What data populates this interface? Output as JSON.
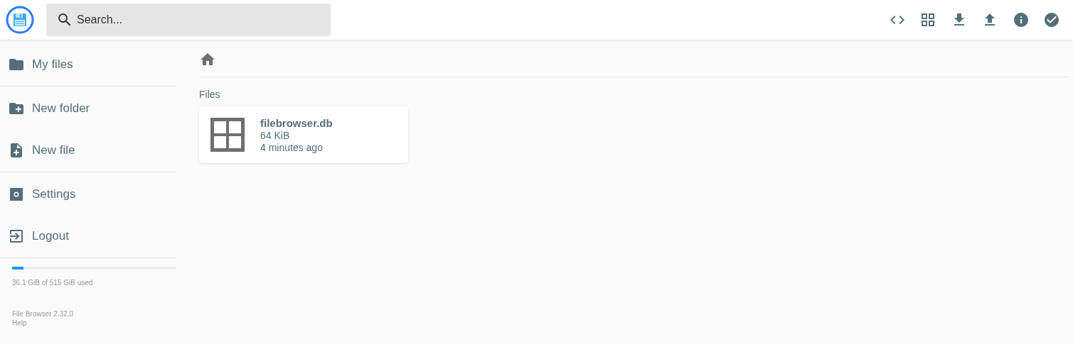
{
  "header": {
    "search": {
      "placeholder": "Search..."
    }
  },
  "sidebar": {
    "groups": [
      [
        {
          "label": "My files"
        }
      ],
      [
        {
          "label": "New folder"
        },
        {
          "label": "New file"
        }
      ],
      [
        {
          "label": "Settings"
        },
        {
          "label": "Logout"
        }
      ]
    ],
    "storage": {
      "level": 0.07,
      "reading": "36.1 GiB of 515 GiB used"
    },
    "footer": {
      "version": "File Browser 2.32.0",
      "help": "Help"
    }
  },
  "main": {
    "section_title": "Files",
    "files": [
      {
        "name": "filebrowser.db",
        "size": "64 KiB",
        "modified": "4 minutes ago"
      }
    ]
  }
}
